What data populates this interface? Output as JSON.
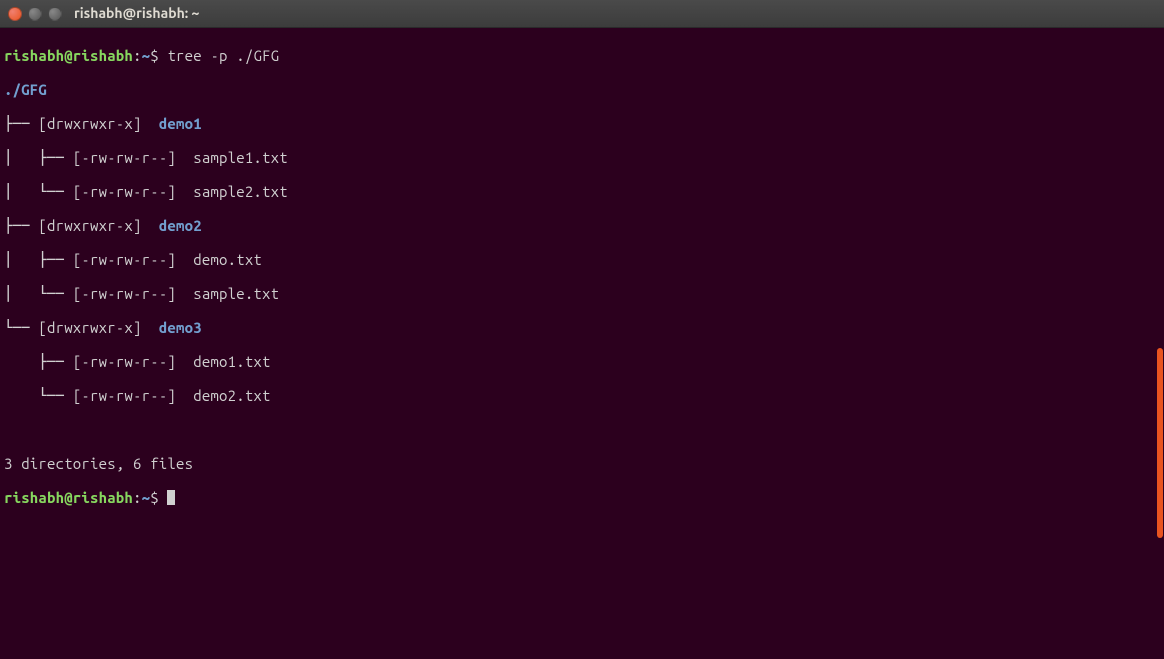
{
  "window": {
    "title": "rishabh@rishabh: ~"
  },
  "prompt": {
    "user_host": "rishabh@rishabh",
    "sep1": ":",
    "path": "~",
    "sep2": "$"
  },
  "command": "tree -p ./GFG",
  "root": "./GFG",
  "tree": {
    "d1_branch": "├── ",
    "d1_perm": "[drwxrwxr-x]  ",
    "d1_name": "demo1",
    "d1_f1_branch": "│   ├── ",
    "d1_f1_perm": "[-rw-rw-r--]  ",
    "d1_f1_name": "sample1.txt",
    "d1_f2_branch": "│   └── ",
    "d1_f2_perm": "[-rw-rw-r--]  ",
    "d1_f2_name": "sample2.txt",
    "d2_branch": "├── ",
    "d2_perm": "[drwxrwxr-x]  ",
    "d2_name": "demo2",
    "d2_f1_branch": "│   ├── ",
    "d2_f1_perm": "[-rw-rw-r--]  ",
    "d2_f1_name": "demo.txt",
    "d2_f2_branch": "│   └── ",
    "d2_f2_perm": "[-rw-rw-r--]  ",
    "d2_f2_name": "sample.txt",
    "d3_branch": "└── ",
    "d3_perm": "[drwxrwxr-x]  ",
    "d3_name": "demo3",
    "d3_f1_branch": "    ├── ",
    "d3_f1_perm": "[-rw-rw-r--]  ",
    "d3_f1_name": "demo1.txt",
    "d3_f2_branch": "    └── ",
    "d3_f2_perm": "[-rw-rw-r--]  ",
    "d3_f2_name": "demo2.txt"
  },
  "summary": "3 directories, 6 files"
}
